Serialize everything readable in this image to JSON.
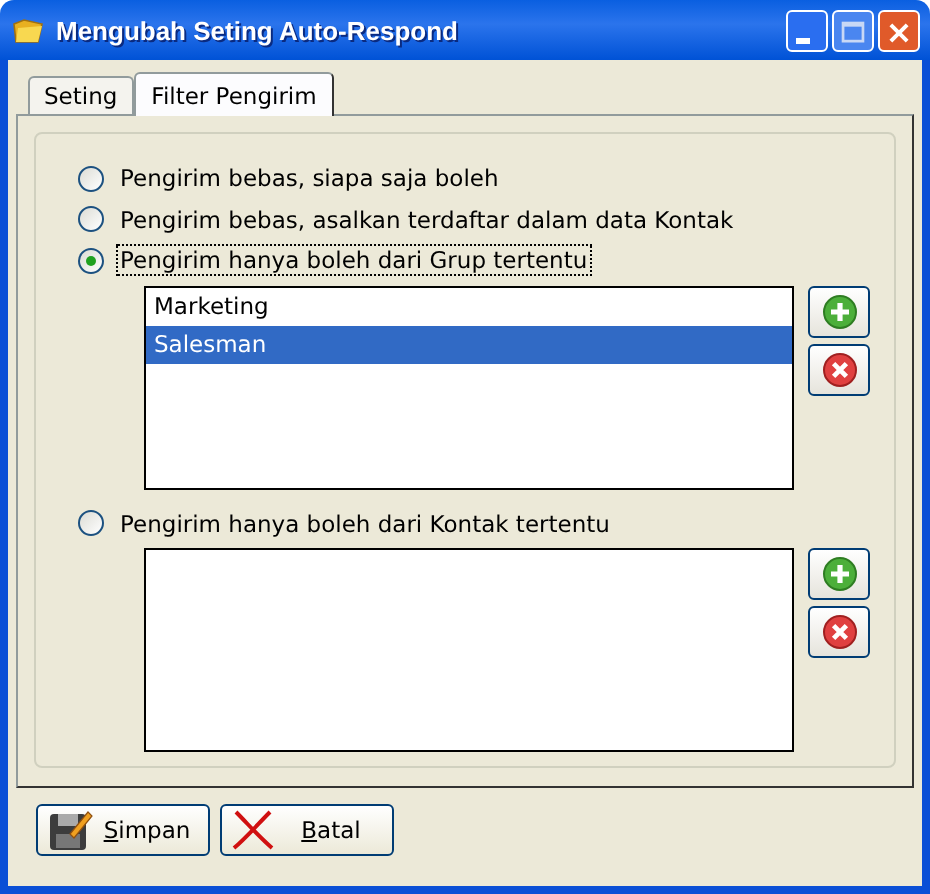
{
  "window": {
    "title": "Mengubah Seting Auto-Respond"
  },
  "tabs": [
    {
      "label": "Seting",
      "selected": false
    },
    {
      "label": "Filter Pengirim",
      "selected": true
    }
  ],
  "options": [
    {
      "kind": "plain",
      "label": "Pengirim bebas, siapa saja boleh",
      "selected": false
    },
    {
      "kind": "plain",
      "label": "Pengirim bebas, asalkan terdaftar dalam data Kontak",
      "selected": false
    },
    {
      "kind": "list",
      "label": "Pengirim hanya boleh dari Grup tertentu",
      "selected": true,
      "items": [
        {
          "label": "Marketing",
          "selected": false
        },
        {
          "label": "Salesman",
          "selected": true
        }
      ]
    },
    {
      "kind": "list",
      "label": "Pengirim hanya boleh dari Kontak tertentu",
      "selected": false
    }
  ],
  "buttons": [
    {
      "kind": "save",
      "label": "Simpan"
    },
    {
      "kind": "cancel",
      "label": "Batal"
    }
  ]
}
